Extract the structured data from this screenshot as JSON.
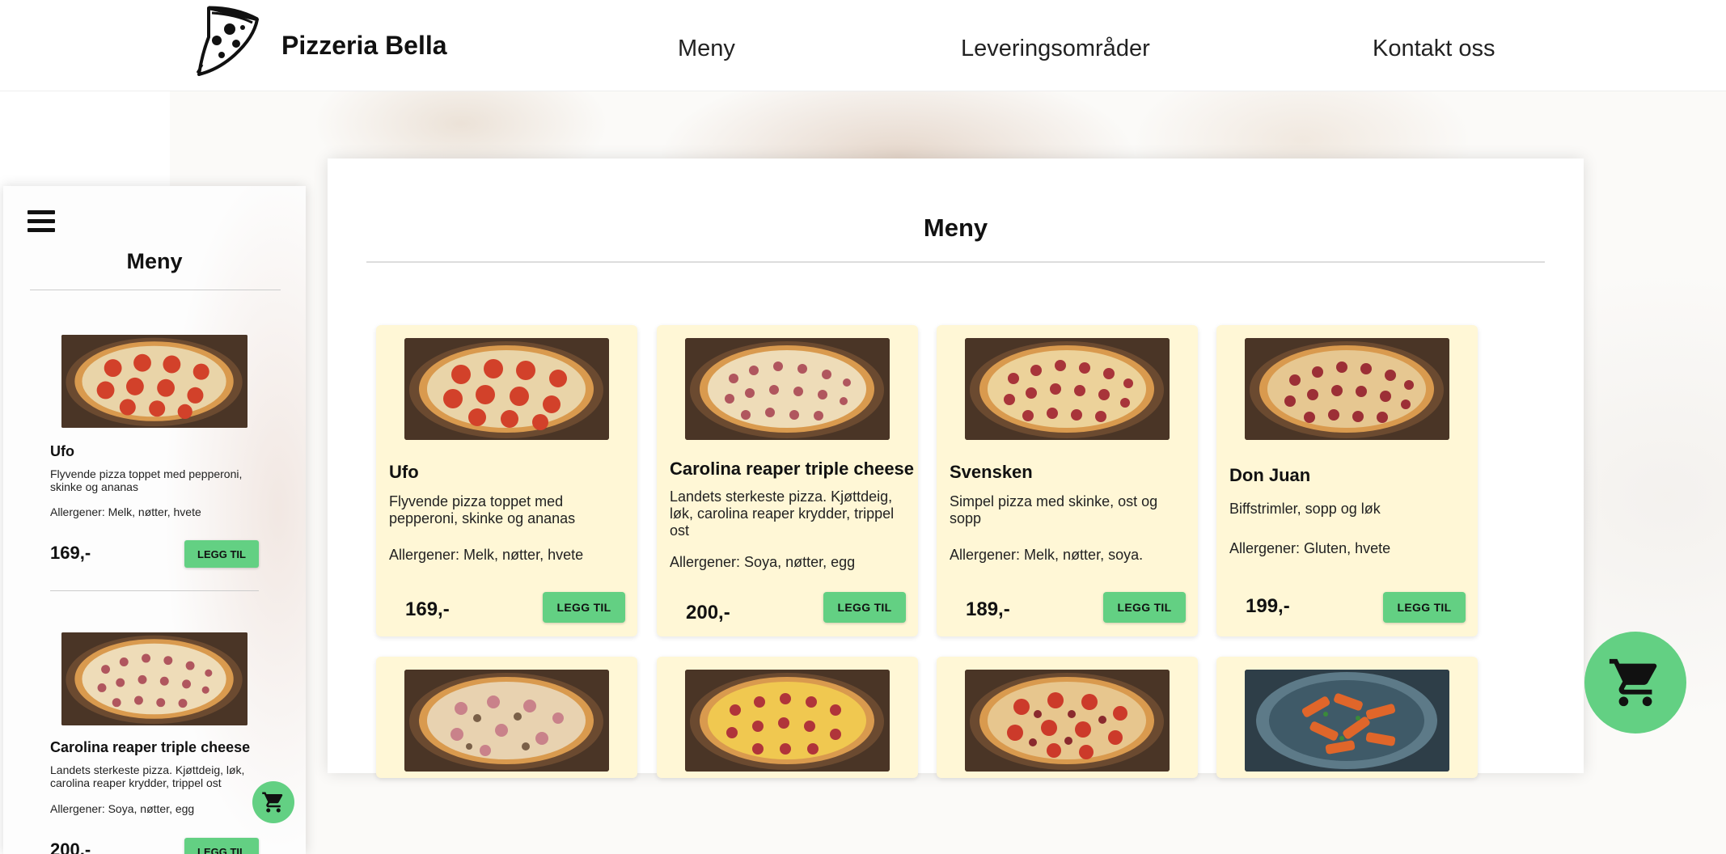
{
  "header": {
    "brand": "Pizzeria Bella",
    "nav": [
      "Meny",
      "Leveringsområder",
      "Kontakt oss"
    ]
  },
  "main": {
    "title": "Meny",
    "add_label": "LEGG TIL",
    "items": [
      {
        "name": "Ufo",
        "desc": "Flyvende pizza toppet med pepperoni, skinke og ananas",
        "allergens": "Allergener: Melk, nøtter, hvete",
        "price": "169,-",
        "image": "tomato-pizza-image"
      },
      {
        "name": "Carolina reaper triple cheese",
        "desc": "Landets sterkeste pizza. Kjøttdeig, løk, carolina reaper krydder, trippel ost",
        "allergens": "Allergener: Soya, nøtter, egg",
        "price": "200,-",
        "image": "ham-cheese-pizza-image"
      },
      {
        "name": "Svensken",
        "desc": "Simpel pizza med skinke, ost og sopp",
        "allergens": "Allergener: Melk, nøtter, soya.",
        "price": "189,-",
        "image": "pepperoni-pizza-image"
      },
      {
        "name": "Don Juan",
        "desc": "Biffstrimler, sopp og løk",
        "allergens": "Allergener: Gluten, hvete",
        "price": "199,-",
        "image": "pepperoni-pizza-image"
      }
    ],
    "second_row_images": [
      "ham-mushroom-pizza-image",
      "pepperoni-corn-pizza-image",
      "tomato-pepperoni-pizza-image",
      "penne-pasta-image"
    ]
  },
  "mobile": {
    "title": "Meny",
    "add_label": "LEGG TIL",
    "items": [
      {
        "name": "Ufo",
        "desc": "Flyvende pizza toppet med pepperoni, skinke og ananas",
        "allergens": "Allergener: Melk, nøtter, hvete",
        "price": "169,-"
      },
      {
        "name": "Carolina reaper triple cheese",
        "desc": "Landets sterkeste pizza. Kjøttdeig, løk, carolina reaper krydder, trippel ost",
        "allergens": "Allergener: Soya, nøtter, egg",
        "price": "200,-"
      }
    ]
  },
  "colors": {
    "accent_green": "#63d083",
    "card_background": "#fff7d6",
    "text": "#111111"
  },
  "icons": [
    "pizza-slice-logo-icon",
    "hamburger-menu-icon",
    "shopping-cart-icon"
  ]
}
